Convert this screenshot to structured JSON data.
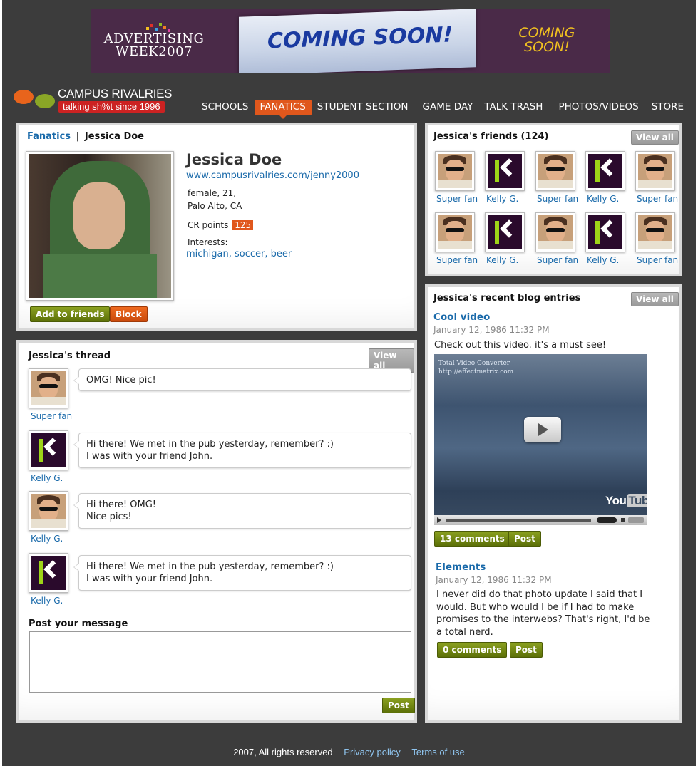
{
  "ad": {
    "left_text_line1": "ADVERTISING",
    "left_text_line2": "WEEK2007",
    "center_text": "COMING SOON!",
    "right_text_line1": "COMING",
    "right_text_line2": "SOON!"
  },
  "header": {
    "logo_title": "CAMPUS RIVALRIES",
    "logo_tagline": "talking sh%t since 1996",
    "nav": [
      "SCHOOLS",
      "FANATICS",
      "STUDENT SECTION",
      "GAME DAY",
      "TALK TRASH",
      "PHOTOS/VIDEOS",
      "STORE"
    ],
    "active_nav": "FANATICS"
  },
  "profile": {
    "breadcrumb_link": "Fanatics",
    "breadcrumb_sep": "|",
    "breadcrumb_current": "Jessica Doe",
    "name": "Jessica Doe",
    "url": "www.campusrivalries.com/jenny2000",
    "details_line1": "female, 21,",
    "details_line2": "Palo Alto, CA",
    "cr_points_label": "CR points",
    "cr_points_value": "125",
    "interests_label": "Interests:",
    "interests": "michigan, soccer, beer",
    "add_button": "Add to friends",
    "block_button": "Block"
  },
  "thread": {
    "title": "Jessica's thread",
    "view_all": "View all",
    "messages": [
      {
        "author": "Super fan",
        "avatar": "super-fan",
        "line1": "OMG! Nice pic!",
        "line2": ""
      },
      {
        "author": "Kelly G.",
        "avatar": "kelly",
        "line1": "Hi there! We met in the pub yesterday, remember? :)",
        "line2": "I was with your friend John."
      },
      {
        "author": "Kelly G.",
        "avatar": "super-fan",
        "line1": "Hi there! OMG!",
        "line2": "Nice pics!"
      },
      {
        "author": "Kelly G.",
        "avatar": "kelly",
        "line1": "Hi there! We met in the pub yesterday, remember? :)",
        "line2": "I was with your friend John."
      }
    ],
    "post_label": "Post your message",
    "post_placeholder": "",
    "post_button": "Post"
  },
  "friends": {
    "title": "Jessica's friends (124)",
    "view_all": "View all",
    "items": [
      {
        "name": "Super fan",
        "avatar": "super-fan"
      },
      {
        "name": "Kelly G.",
        "avatar": "kelly"
      },
      {
        "name": "Super fan",
        "avatar": "super-fan"
      },
      {
        "name": "Kelly G.",
        "avatar": "kelly"
      },
      {
        "name": "Super fan",
        "avatar": "super-fan"
      },
      {
        "name": "Super fan",
        "avatar": "super-fan"
      },
      {
        "name": "Kelly G.",
        "avatar": "kelly"
      },
      {
        "name": "Super fan",
        "avatar": "super-fan"
      },
      {
        "name": "Kelly G.",
        "avatar": "kelly"
      },
      {
        "name": "Super fan",
        "avatar": "super-fan"
      }
    ]
  },
  "blog": {
    "title": "Jessica's recent blog entries",
    "view_all": "View all",
    "entries": [
      {
        "title": "Cool video",
        "date": "January 12, 1986 11:32 PM",
        "body": "Check out this video. it's a must see!",
        "video_overlay_text": "Total Video Converter",
        "video_overlay_url": "http://effectmatrix.com",
        "video_brand_1": "You",
        "video_brand_2": "Tube",
        "comments_button": "13 comments",
        "post_button": "Post"
      },
      {
        "title": "Elements",
        "date": "January 12, 1986 11:32 PM",
        "body_lines": [
          "I never did do that photo update I said that I",
          "would. But who would I be if I had to make",
          "promises to the interwebs? That's right, I'd be",
          "a total nerd."
        ],
        "comments_button": "0 comments",
        "post_button": "Post"
      }
    ]
  },
  "footer": {
    "copyright": "2007, All rights reserved",
    "privacy": "Privacy policy",
    "terms": "Terms of use"
  }
}
